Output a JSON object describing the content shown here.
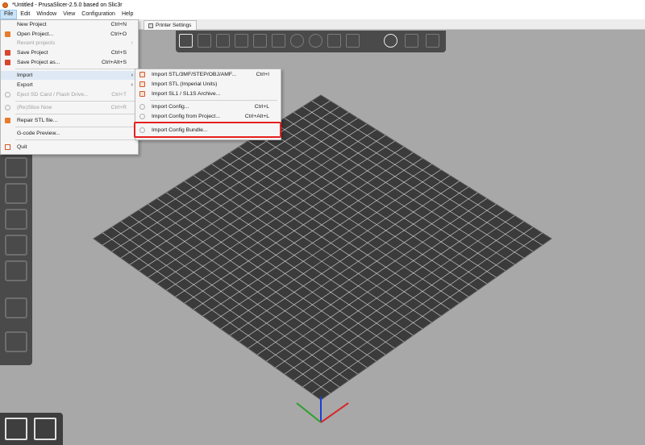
{
  "window": {
    "title": "*Untitled - PrusaSlicer-2.5.0 based on Slic3r"
  },
  "menubar": [
    "File",
    "Edit",
    "Window",
    "View",
    "Configuration",
    "Help"
  ],
  "tabs": {
    "printer_settings": "Printer Settings"
  },
  "file_menu": [
    {
      "label": "New Project",
      "shortcut": "Ctrl+N",
      "icon": "new-project-icon",
      "disabled": false
    },
    {
      "label": "Open Project...",
      "shortcut": "Ctrl+O",
      "icon": "open-folder-icon",
      "disabled": false
    },
    {
      "label": "Recent projects",
      "shortcut": "",
      "icon": "",
      "disabled": true,
      "submenu": true
    },
    {
      "label": "Save Project",
      "shortcut": "Ctrl+S",
      "icon": "save-icon",
      "disabled": false
    },
    {
      "label": "Save Project as...",
      "shortcut": "Ctrl+Alt+S",
      "icon": "save-as-icon",
      "disabled": false
    },
    {
      "label": "Import",
      "shortcut": "",
      "icon": "",
      "disabled": false,
      "submenu": true,
      "highlight": true
    },
    {
      "label": "Export",
      "shortcut": "",
      "icon": "",
      "disabled": false,
      "submenu": true
    },
    {
      "label": "Eject SD Card / Flash Drive...",
      "shortcut": "Ctrl+T",
      "icon": "eject-icon",
      "disabled": true
    },
    {
      "label": "(Re)Slice Now",
      "shortcut": "Ctrl+R",
      "icon": "reslice-icon",
      "disabled": true
    },
    {
      "label": "Repair STL file...",
      "shortcut": "",
      "icon": "repair-icon",
      "disabled": false
    },
    {
      "label": "G-code Preview...",
      "shortcut": "",
      "icon": "",
      "disabled": false
    },
    {
      "label": "Quit",
      "shortcut": "",
      "icon": "quit-icon",
      "disabled": false
    }
  ],
  "import_menu": [
    {
      "label": "Import STL/3MF/STEP/OBJ/AMF...",
      "shortcut": "Ctrl+I"
    },
    {
      "label": "Import STL (Imperial Units)",
      "shortcut": ""
    },
    {
      "label": "Import SL1 / SL1S Archive...",
      "shortcut": ""
    },
    {
      "label": "Import Config...",
      "shortcut": "Ctrl+L"
    },
    {
      "label": "Import Config from Project...",
      "shortcut": "Ctrl+Alt+L"
    },
    {
      "label": "Import Config Bundle...",
      "shortcut": ""
    }
  ],
  "colors": {
    "highlight_box": "#e62020",
    "bed": "#3b3b3b",
    "grid_line": "#e8e8e8",
    "viewport": "#a8a8a8"
  }
}
